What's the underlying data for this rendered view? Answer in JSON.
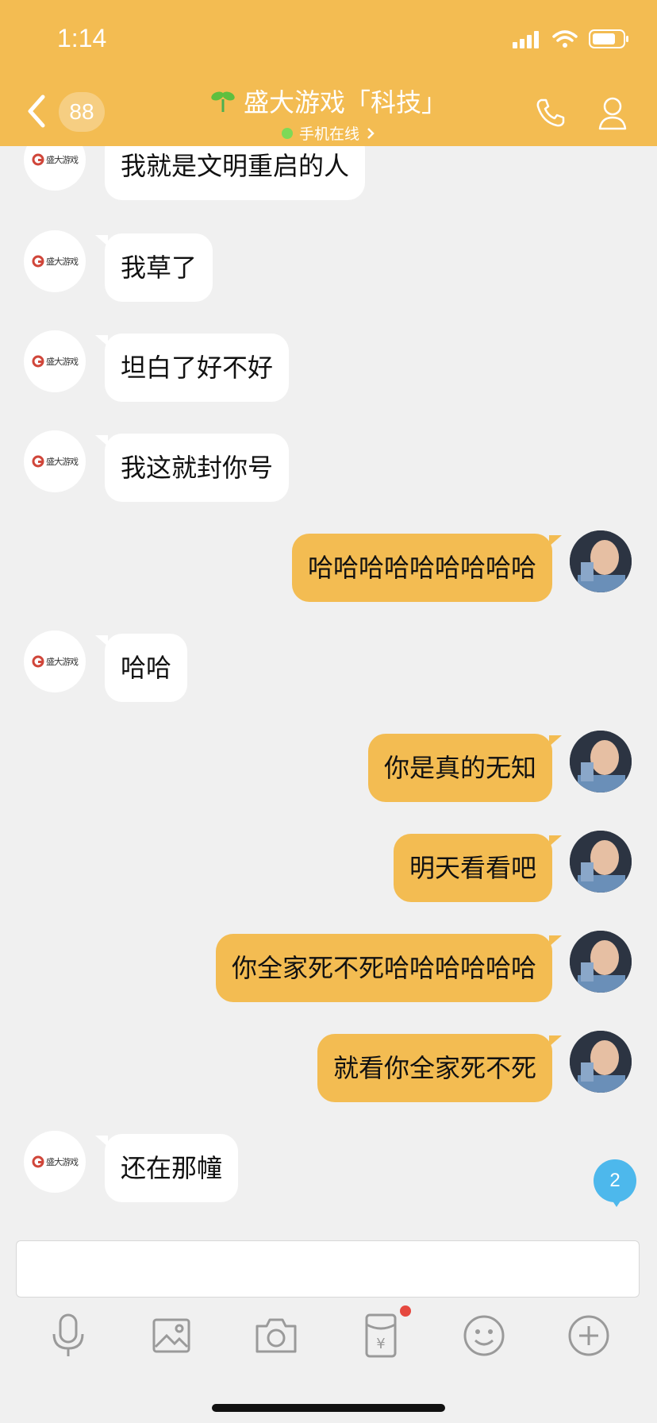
{
  "status_bar": {
    "time": "1:14"
  },
  "header": {
    "badge_count": "88",
    "title": "盛大游戏「科技」",
    "subtitle": "手机在线"
  },
  "contact": {
    "logo_text": "盛大游戏"
  },
  "messages": [
    {
      "side": "in",
      "text": "我就是文明重启的人"
    },
    {
      "side": "in",
      "text": "我草了"
    },
    {
      "side": "in",
      "text": "坦白了好不好"
    },
    {
      "side": "in",
      "text": "我这就封你号"
    },
    {
      "side": "out",
      "text": "哈哈哈哈哈哈哈哈哈"
    },
    {
      "side": "in",
      "text": "哈哈"
    },
    {
      "side": "out",
      "text": "你是真的无知"
    },
    {
      "side": "out",
      "text": "明天看看吧"
    },
    {
      "side": "out",
      "text": "你全家死不死哈哈哈哈哈哈"
    },
    {
      "side": "out",
      "text": "就看你全家死不死"
    },
    {
      "side": "in",
      "text": "还在那幢"
    }
  ],
  "unread_count": "2",
  "input": {
    "value": "",
    "placeholder": ""
  },
  "toolbar": [
    "microphone-icon",
    "image-icon",
    "camera-icon",
    "red-packet-icon",
    "emoji-icon",
    "plus-icon"
  ],
  "colors": {
    "header": "#f3bc52",
    "outgoing_bubble": "#f3bc52",
    "incoming_bubble": "#ffffff",
    "background": "#f0f0f0",
    "unread_badge": "#4db8ec"
  }
}
